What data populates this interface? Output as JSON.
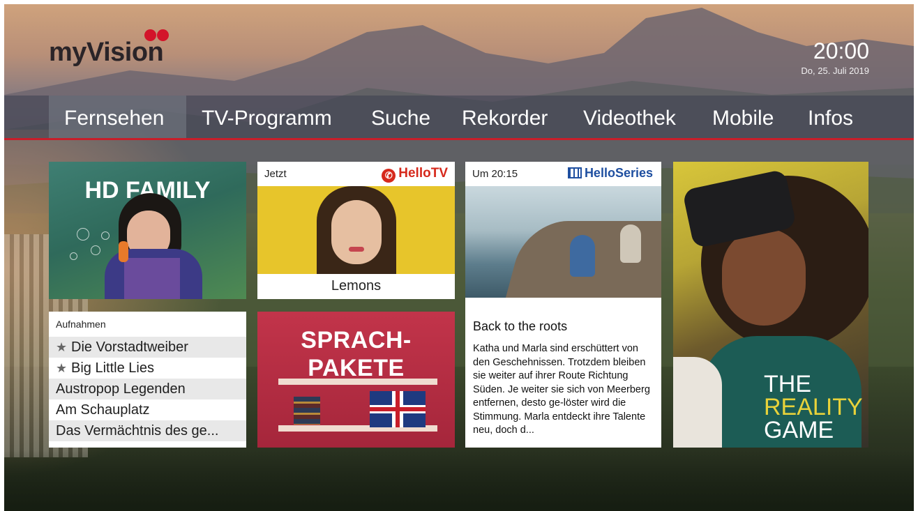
{
  "header": {
    "logo_text": "myVision",
    "time": "20:00",
    "date": "Do, 25. Juli 2019"
  },
  "nav": {
    "items": [
      "Fernsehen",
      "TV-Programm",
      "Suche",
      "Rekorder",
      "Videothek",
      "Mobile",
      "Infos"
    ],
    "active": "Fernsehen"
  },
  "tiles": {
    "hd_family": {
      "title": "HD FAMILY"
    },
    "recordings": {
      "header": "Aufnahmen",
      "items": [
        {
          "label": "Die Vorstadtweiber",
          "starred": true
        },
        {
          "label": "Big Little Lies",
          "starred": true
        },
        {
          "label": "Austropop Legenden",
          "starred": false
        },
        {
          "label": "Am Schauplatz",
          "starred": false
        },
        {
          "label": "Das Vermächtnis des ge...",
          "starred": false
        }
      ]
    },
    "hellotv": {
      "now_label": "Jetzt",
      "brand": "HelloTV",
      "caption": "Lemons"
    },
    "sprachpakete": {
      "line1": "SPRACH-",
      "line2": "PAKETE"
    },
    "helloseries": {
      "time_label": "Um 20:15",
      "brand": "HelloSeries",
      "title": "Back to the roots",
      "description": "Katha und Marla sind erschüttert von den Geschehnissen. Trotzdem bleiben sie weiter auf ihrer Route Richtung Süden. Je weiter sie sich von Meerberg entfernen, desto ge-löster wird die Stimmung. Marla entdeckt ihre Talente neu, doch d..."
    },
    "reality_game": {
      "line1": "THE",
      "line2": "REALITY",
      "line3": "GAME"
    }
  },
  "colors": {
    "accent": "#c81e2a",
    "hellotv_brand": "#d6291c",
    "helloseries_brand": "#1f4fa0"
  }
}
